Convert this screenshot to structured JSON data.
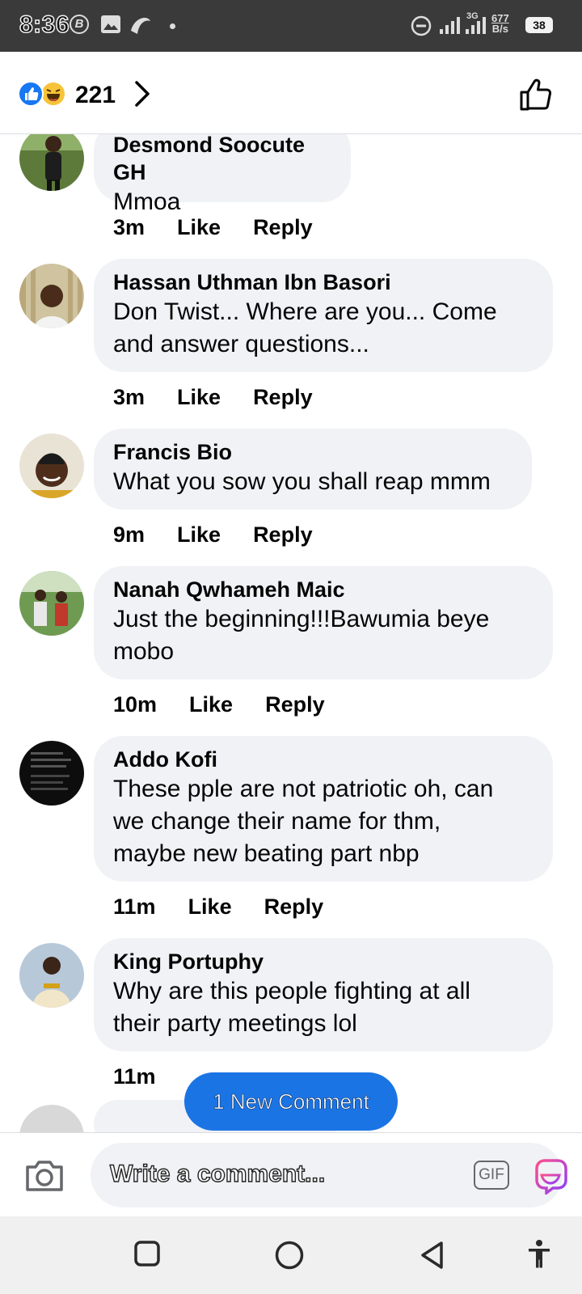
{
  "status_bar": {
    "time": "8:36",
    "network_type": "3G",
    "net_speed_value": "677",
    "net_speed_unit": "B/s",
    "battery": "38"
  },
  "reactions": {
    "count": "221"
  },
  "comments": [
    {
      "author": "Desmond Soocute GH",
      "text": "Mmoa",
      "time": "3m",
      "like": "Like",
      "reply": "Reply"
    },
    {
      "author": "Hassan Uthman Ibn Basori",
      "text_lines": [
        "Don Twist... Where are you... Come",
        "and answer questions..."
      ],
      "time": "3m",
      "like": "Like",
      "reply": "Reply"
    },
    {
      "author": "Francis Bio",
      "text": "What you sow you shall reap mmm",
      "time": "9m",
      "like": "Like",
      "reply": "Reply"
    },
    {
      "author": "Nanah Qwhameh Maic",
      "text_lines": [
        "Just the beginning!!!Bawumia beye",
        "mobo"
      ],
      "time": "10m",
      "like": "Like",
      "reply": "Reply"
    },
    {
      "author": "Addo Kofi",
      "text_lines": [
        "These pple are not patriotic oh, can",
        "we change their name for thm,",
        "maybe new beating part nbp"
      ],
      "time": "11m",
      "like": "Like",
      "reply": "Reply"
    },
    {
      "author": "King Portuphy",
      "text_lines": [
        "Why are this people fighting at all",
        "their party meetings lol"
      ],
      "time": "11m"
    }
  ],
  "new_comment_pill": "1 New Comment",
  "composer": {
    "placeholder": "Write a comment...",
    "gif_label": "GIF"
  },
  "colors": {
    "accent": "#1877f2",
    "bubble": "#f0f2f5",
    "pill": "#1b74e4"
  }
}
